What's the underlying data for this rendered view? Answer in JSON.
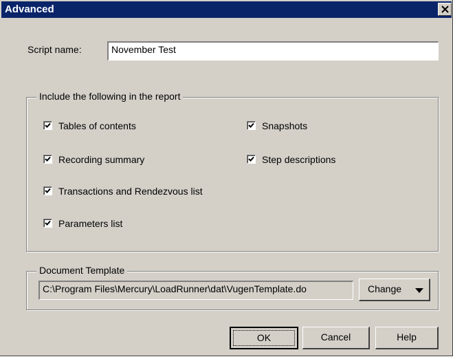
{
  "dialog": {
    "title": "Advanced"
  },
  "script_name": {
    "label": "Script name:",
    "value": "November Test"
  },
  "report_group": {
    "legend": "Include the following in the report",
    "checkboxes": [
      {
        "label": "Tables of contents",
        "checked": true
      },
      {
        "label": "Recording summary",
        "checked": true
      },
      {
        "label": "Transactions and Rendezvous list",
        "checked": true
      },
      {
        "label": "Parameters list",
        "checked": true
      },
      {
        "label": "Snapshots",
        "checked": true
      },
      {
        "label": "Step descriptions",
        "checked": true
      }
    ]
  },
  "template_group": {
    "legend": "Document Template",
    "path": "C:\\Program Files\\Mercury\\LoadRunner\\dat\\VugenTemplate.do",
    "change_label": "Change"
  },
  "buttons": {
    "ok": "OK",
    "cancel": "Cancel",
    "help": "Help"
  },
  "icons": {
    "close": "close-icon",
    "dropdown": "triangle-down-icon",
    "check": "checkmark-icon"
  }
}
